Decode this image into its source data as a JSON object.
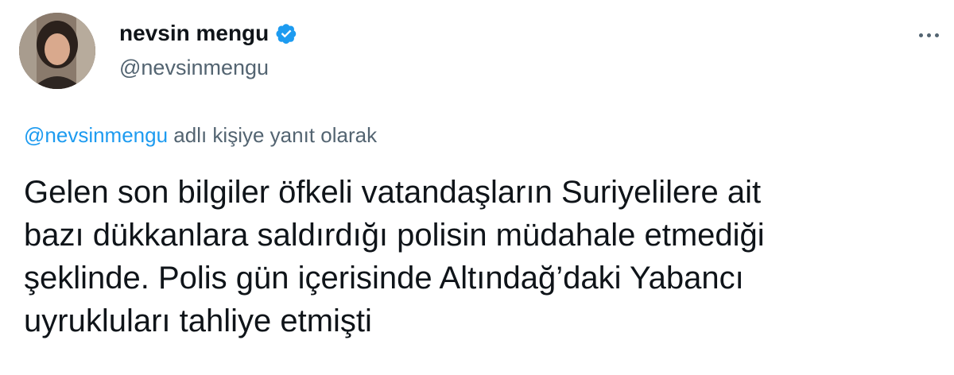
{
  "author": {
    "display_name": "nevsin mengu",
    "handle": "@nevsinmengu",
    "verified": true,
    "avatar_icon": "profile-photo"
  },
  "reply_context": {
    "handle": "@nevsinmengu",
    "suffix": " adlı kişiye yanıt olarak"
  },
  "tweet": {
    "lines": [
      "Gelen son bilgiler öfkeli vatandaşların Suriyelilere ait",
      "bazı dükkanlara saldırdığı polisin müdahale etmediği",
      "şeklinde. Polis gün içerisinde Altındağ’daki Yabancı",
      "uyrukluları tahliye etmişti"
    ]
  },
  "colors": {
    "accent": "#1d9bf0",
    "secondary_text": "#536471",
    "primary_text": "#0f1419"
  },
  "icons": {
    "verified": "verified-badge-icon",
    "more": "more-options-icon"
  }
}
